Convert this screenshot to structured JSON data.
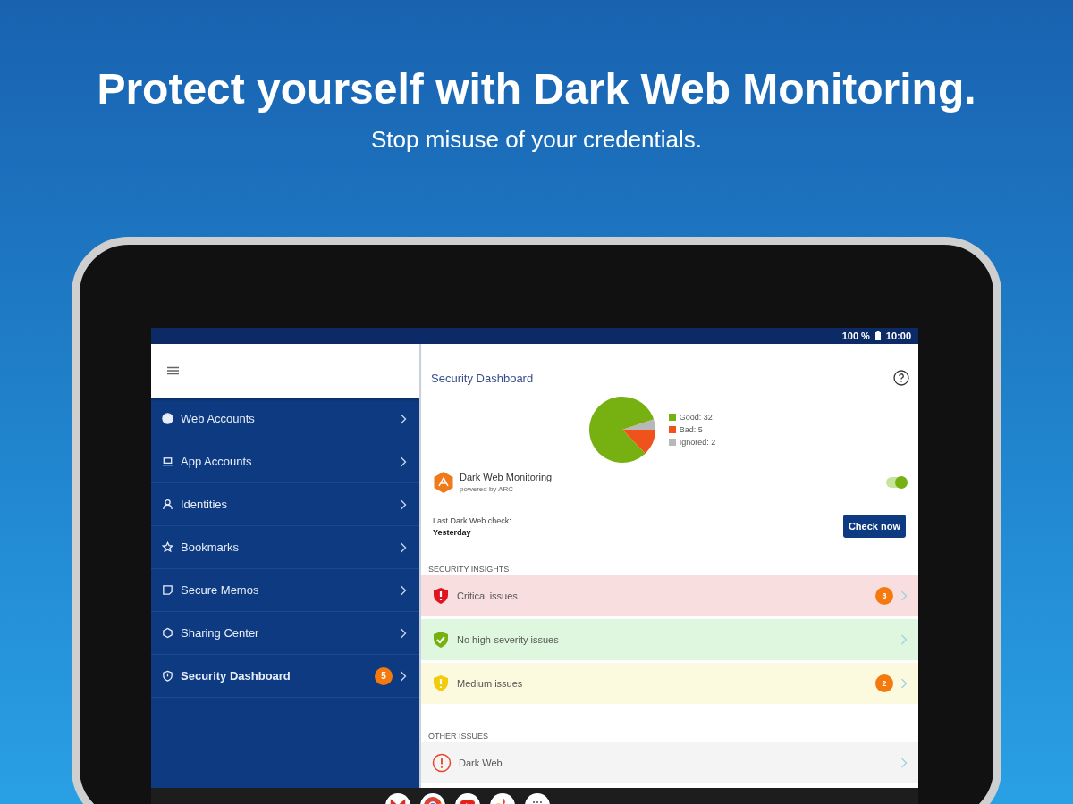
{
  "headline": "Protect yourself with Dark Web Monitoring.",
  "subtitle": "Stop misuse of your credentials.",
  "status_bar": {
    "battery": "100 %",
    "time": "10:00"
  },
  "sidebar": {
    "items": [
      {
        "kind": "globe",
        "label": "Web Accounts",
        "selected": false
      },
      {
        "kind": "laptop",
        "label": "App Accounts",
        "selected": false
      },
      {
        "kind": "person",
        "label": "Identities",
        "selected": false
      },
      {
        "kind": "star",
        "label": "Bookmarks",
        "selected": false
      },
      {
        "kind": "memo",
        "label": "Secure Memos",
        "selected": false
      },
      {
        "kind": "share",
        "label": "Sharing Center",
        "selected": false
      },
      {
        "kind": "shield",
        "label": "Security Dashboard",
        "selected": true,
        "badge": "5"
      }
    ]
  },
  "dashboard": {
    "title": "Security Dashboard",
    "chart_data": {
      "type": "pie",
      "categories": [
        "Good: 32",
        "Bad: 5",
        "Ignored: 2"
      ],
      "values": [
        32,
        5,
        2
      ],
      "colors": [
        "#77b011",
        "#f0521c",
        "#b8b8b8"
      ]
    },
    "monitoring": {
      "title": "Dark Web Monitoring",
      "subtitle": "powered by ARC",
      "on": true
    },
    "last_check": {
      "label": "Last Dark Web check:",
      "value": "Yesterday",
      "button": "Check now"
    },
    "sections": [
      {
        "heading": "SECURITY INSIGHTS",
        "rows": [
          {
            "kind": "critical",
            "label": "Critical issues",
            "count": "3"
          },
          {
            "kind": "ok",
            "label": "No high-severity issues"
          },
          {
            "kind": "medium",
            "label": "Medium issues",
            "count": "2"
          }
        ]
      },
      {
        "heading": "OTHER ISSUES",
        "rows": [
          {
            "kind": "alert",
            "label": "Dark Web"
          }
        ]
      }
    ]
  }
}
